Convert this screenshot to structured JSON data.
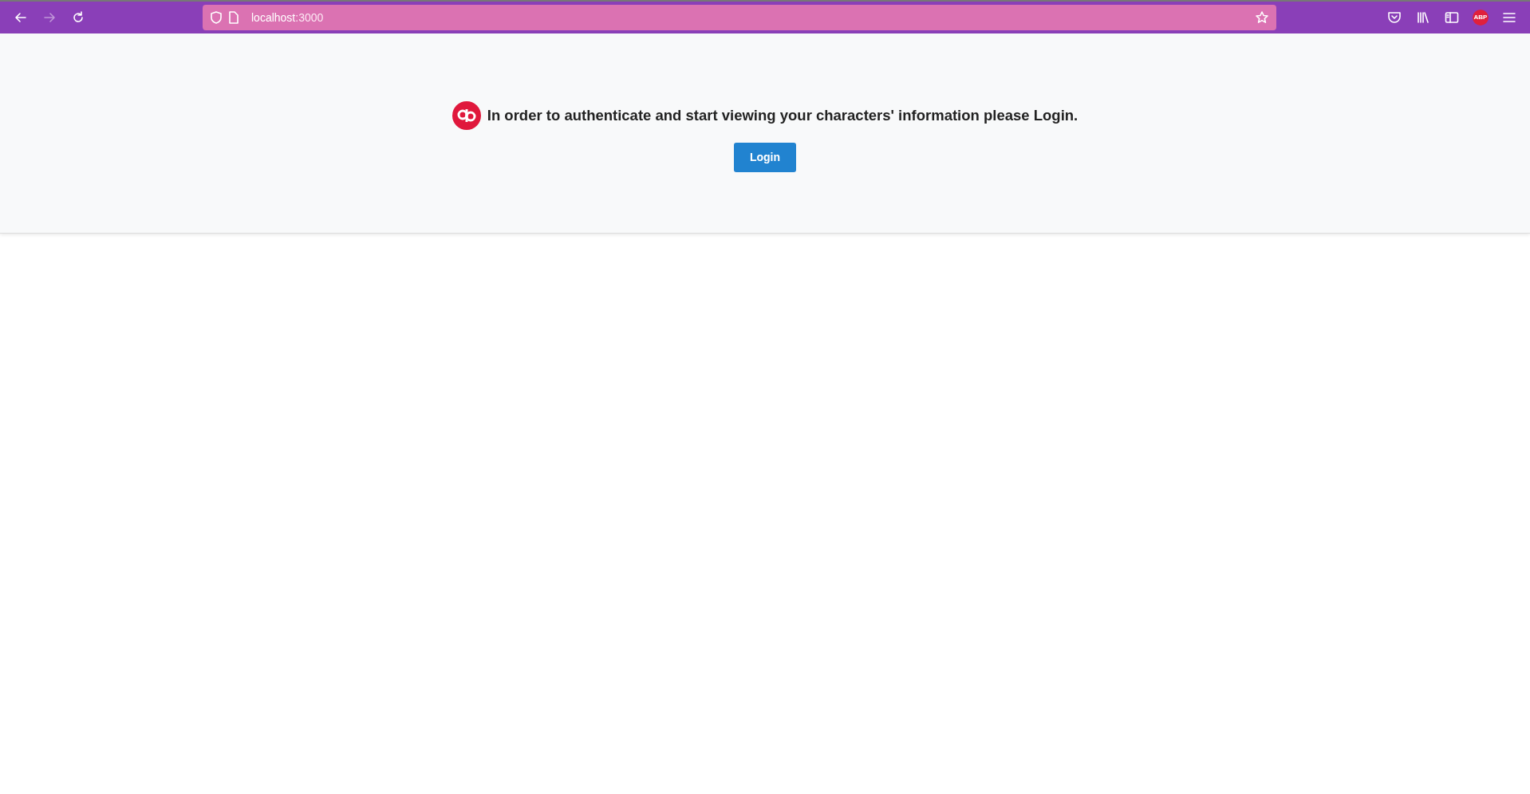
{
  "browser": {
    "nav_buttons": [
      {
        "kind": "back",
        "disabled": false
      },
      {
        "kind": "forward",
        "disabled": true
      },
      {
        "kind": "reload",
        "disabled": false
      }
    ],
    "address": {
      "host": "localhost",
      "port": ":3000"
    },
    "extensions": [
      {
        "kind": "pocket"
      },
      {
        "kind": "library"
      },
      {
        "kind": "sidebar"
      },
      {
        "kind": "adblock",
        "label": "ABP"
      },
      {
        "kind": "menu"
      }
    ]
  },
  "page": {
    "message": "In order to authenticate and start viewing your characters' information please Login.",
    "button": "Login"
  }
}
